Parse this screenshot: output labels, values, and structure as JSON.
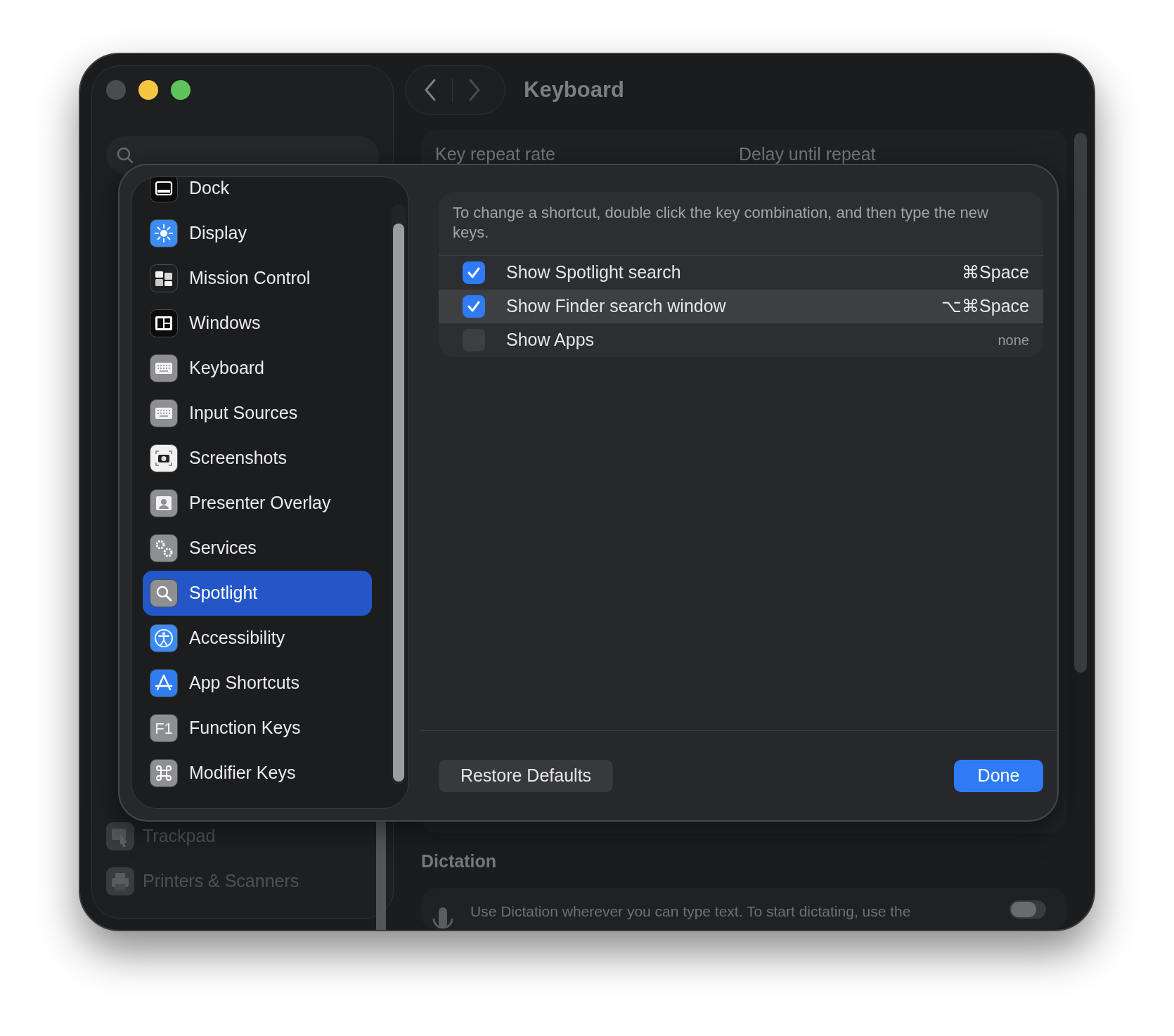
{
  "window": {
    "title": "Keyboard",
    "sidebar_items": [
      {
        "label": "Trackpad"
      },
      {
        "label": "Printers & Scanners"
      }
    ]
  },
  "content": {
    "labels": [
      "Key repeat rate",
      "Delay until repeat"
    ],
    "dictation": {
      "heading": "Dictation",
      "description": "Use Dictation wherever you can type text. To start dictating, use the",
      "on": false
    }
  },
  "sheet": {
    "categories": [
      {
        "label": "Dock",
        "selected": false
      },
      {
        "label": "Display",
        "selected": false
      },
      {
        "label": "Mission Control",
        "selected": false
      },
      {
        "label": "Windows",
        "selected": false
      },
      {
        "label": "Keyboard",
        "selected": false
      },
      {
        "label": "Input Sources",
        "selected": false
      },
      {
        "label": "Screenshots",
        "selected": false
      },
      {
        "label": "Presenter Overlay",
        "selected": false
      },
      {
        "label": "Services",
        "selected": false
      },
      {
        "label": "Spotlight",
        "selected": true
      },
      {
        "label": "Accessibility",
        "selected": false
      },
      {
        "label": "App Shortcuts",
        "selected": false
      },
      {
        "label": "Function Keys",
        "selected": false,
        "icon_text": "F1"
      },
      {
        "label": "Modifier Keys",
        "selected": false
      }
    ],
    "description": "To change a shortcut, double click the key combination, and then type the new keys.",
    "shortcuts": [
      {
        "label": "Show Spotlight search",
        "keys": "⌘Space",
        "checked": true,
        "selected": false
      },
      {
        "label": "Show Finder search window",
        "keys": "⌥⌘Space",
        "checked": true,
        "selected": true
      },
      {
        "label": "Show Apps",
        "keys": "none",
        "checked": false,
        "selected": false,
        "kind": "none"
      }
    ],
    "buttons": [
      {
        "label": "Restore Defaults",
        "kind": "secondary"
      },
      {
        "label": "Done",
        "kind": "primary"
      }
    ]
  }
}
